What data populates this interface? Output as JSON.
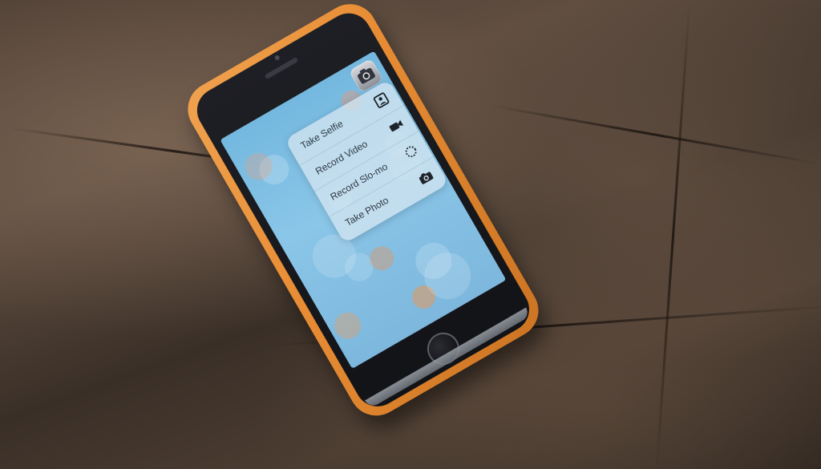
{
  "photo": {
    "camera_shortcuts": {
      "items": [
        {
          "label": "Take Selfie",
          "icon": "selfie-icon"
        },
        {
          "label": "Record Video",
          "icon": "video-camera-icon"
        },
        {
          "label": "Record Slo-mo",
          "icon": "slo-mo-icon"
        },
        {
          "label": "Take Photo",
          "icon": "camera-icon"
        }
      ]
    },
    "app_icon": "camera-app-icon",
    "colors": {
      "case": "#e88d35",
      "screen": "#8ac6e8",
      "menu": "#d2e4f0"
    }
  }
}
